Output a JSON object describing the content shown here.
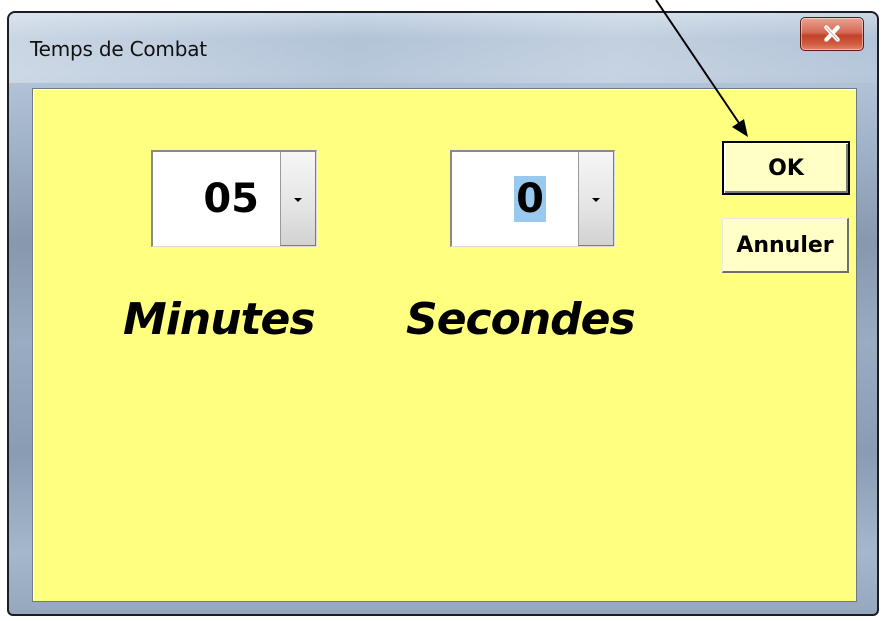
{
  "window": {
    "title": "Temps de Combat",
    "close_label": "X"
  },
  "minutes": {
    "value": "05",
    "label": "Minutes"
  },
  "seconds": {
    "value": "0",
    "label": "Secondes"
  },
  "buttons": {
    "ok_label": "OK",
    "cancel_label": "Annuler"
  },
  "colors": {
    "client_background": "#ffff80",
    "button_face": "#ffffc6",
    "selection_highlight": "#99c9ef",
    "close_button": "#c2412a"
  },
  "icons": {
    "close": "close-icon",
    "spin_down": "arrow-down-icon",
    "annotation": "annotation-arrow-icon"
  }
}
